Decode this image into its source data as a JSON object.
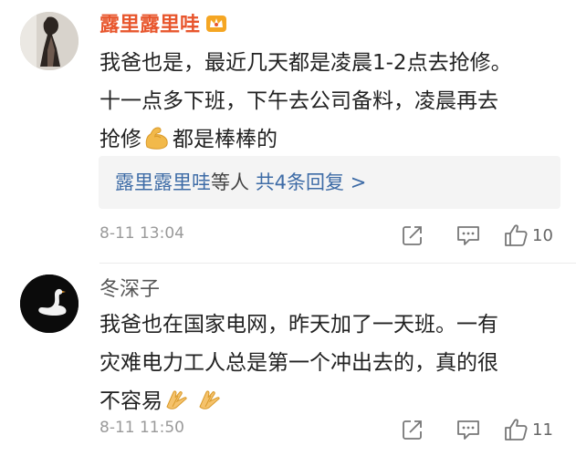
{
  "comments": [
    {
      "username": "露里露里哇",
      "badge_icon": "crown-vip-icon",
      "content_lines": [
        "我爸也是，最近几天都是凌晨1-2点去抢修。",
        "十一点多下班，下午去公司备料，凌晨再去",
        "抢修",
        "都是棒棒的"
      ],
      "content_emoji": "flexed-biceps",
      "reply_summary": {
        "names": "露里露里哇",
        "others": "等人",
        "count_text": "共4条回复 >"
      },
      "timestamp": "8-11 13:04",
      "like_count": "10"
    },
    {
      "username": "冬深子",
      "content_lines": [
        "我爸也在国家电网，昨天加了一天班。一有",
        "灾难电力工人总是第一个冲出去的，真的很",
        "不容易"
      ],
      "content_emoji": "applause-hands",
      "timestamp": "8-11 11:50",
      "like_count": "11"
    }
  ],
  "colors": {
    "username_highlight": "#e8562d",
    "link_blue": "#3d6ba6",
    "muted_text": "#9a9a9a",
    "reply_bg": "#f4f4f4"
  }
}
